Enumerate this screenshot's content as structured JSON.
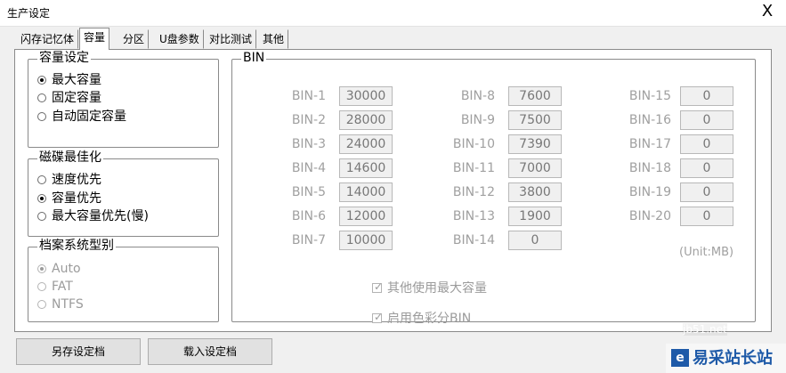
{
  "window": {
    "title": "生产设定",
    "close_label": "X"
  },
  "tabs": [
    "闪存记忆体",
    "容量",
    "分区",
    "U盘参数",
    "对比测试",
    "其他"
  ],
  "active_tab": "容量",
  "capacity_settings": {
    "title": "容量设定",
    "options": [
      "最大容量",
      "固定容量",
      "自动固定容量"
    ],
    "selected": "最大容量"
  },
  "disk_opt": {
    "title": "磁碟最佳化",
    "options": [
      "速度优先",
      "容量优先",
      "最大容量优先(慢)"
    ],
    "selected": "容量优先"
  },
  "file_system": {
    "title": "档案系统型别",
    "options": [
      "Auto",
      "FAT",
      "NTFS"
    ],
    "selected": "Auto",
    "disabled": true
  },
  "bin": {
    "title": "BIN",
    "items": [
      {
        "label": "BIN-1",
        "value": "30000"
      },
      {
        "label": "BIN-2",
        "value": "28000"
      },
      {
        "label": "BIN-3",
        "value": "24000"
      },
      {
        "label": "BIN-4",
        "value": "14600"
      },
      {
        "label": "BIN-5",
        "value": "14000"
      },
      {
        "label": "BIN-6",
        "value": "12000"
      },
      {
        "label": "BIN-7",
        "value": "10000"
      },
      {
        "label": "BIN-8",
        "value": "7600"
      },
      {
        "label": "BIN-9",
        "value": "7500"
      },
      {
        "label": "BIN-10",
        "value": "7390"
      },
      {
        "label": "BIN-11",
        "value": "7000"
      },
      {
        "label": "BIN-12",
        "value": "3800"
      },
      {
        "label": "BIN-13",
        "value": "1900"
      },
      {
        "label": "BIN-14",
        "value": "0"
      },
      {
        "label": "BIN-15",
        "value": "0"
      },
      {
        "label": "BIN-16",
        "value": "0"
      },
      {
        "label": "BIN-17",
        "value": "0"
      },
      {
        "label": "BIN-18",
        "value": "0"
      },
      {
        "label": "BIN-19",
        "value": "0"
      },
      {
        "label": "BIN-20",
        "value": "0"
      }
    ],
    "unit": "(Unit:MB)",
    "checks": [
      {
        "label": "其他使用最大容量",
        "checked": true
      },
      {
        "label": "启用色彩分BIN",
        "checked": true
      }
    ]
  },
  "buttons": {
    "save": "另存设定档",
    "load": "载入设定档"
  },
  "watermark": {
    "site": "jb51.net",
    "brand": "易采站长站",
    "logo": "e"
  }
}
